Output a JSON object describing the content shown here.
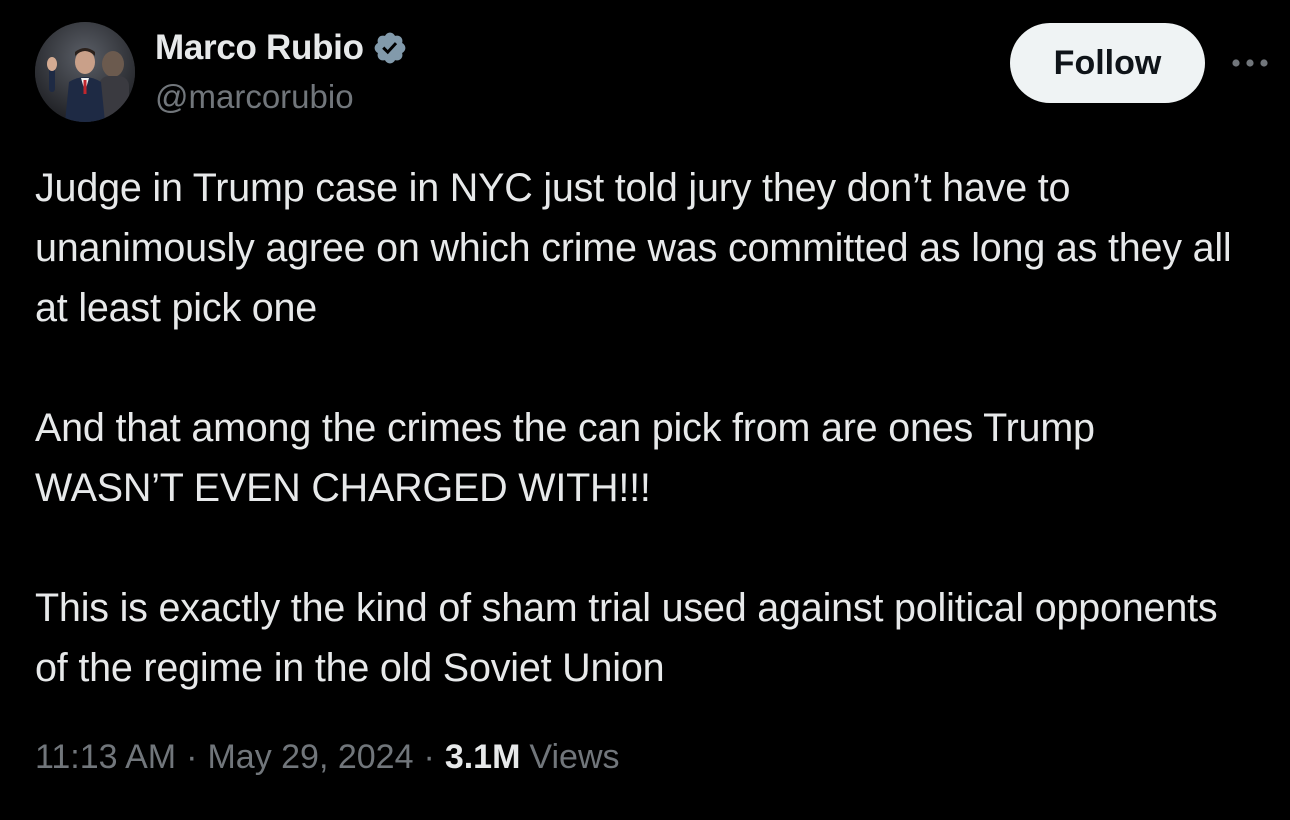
{
  "author": {
    "display_name": "Marco Rubio",
    "handle": "@marcorubio",
    "verified_icon": "verified-badge-icon",
    "verified_color": "#829aab"
  },
  "actions": {
    "follow_label": "Follow",
    "more_icon": "more-horizontal-icon"
  },
  "tweet": {
    "paragraphs": [
      "Judge in Trump case in NYC just told jury they don’t have to unanimously agree on which crime was committed as long as they all at least pick one",
      "And that among the crimes the can pick from are ones Trump WASN’T EVEN CHARGED WITH!!!",
      "This is exactly the kind of sham trial used against political opponents of the regime in the old Soviet Union"
    ]
  },
  "meta": {
    "time": "11:13 AM",
    "separator": "·",
    "date": "May 29, 2024",
    "views_count": "3.1M",
    "views_label": "Views"
  },
  "colors": {
    "background": "#000000",
    "text_primary": "#e7e9ea",
    "text_secondary": "#71767b",
    "follow_bg": "#eff3f4",
    "follow_text": "#0f1419"
  }
}
